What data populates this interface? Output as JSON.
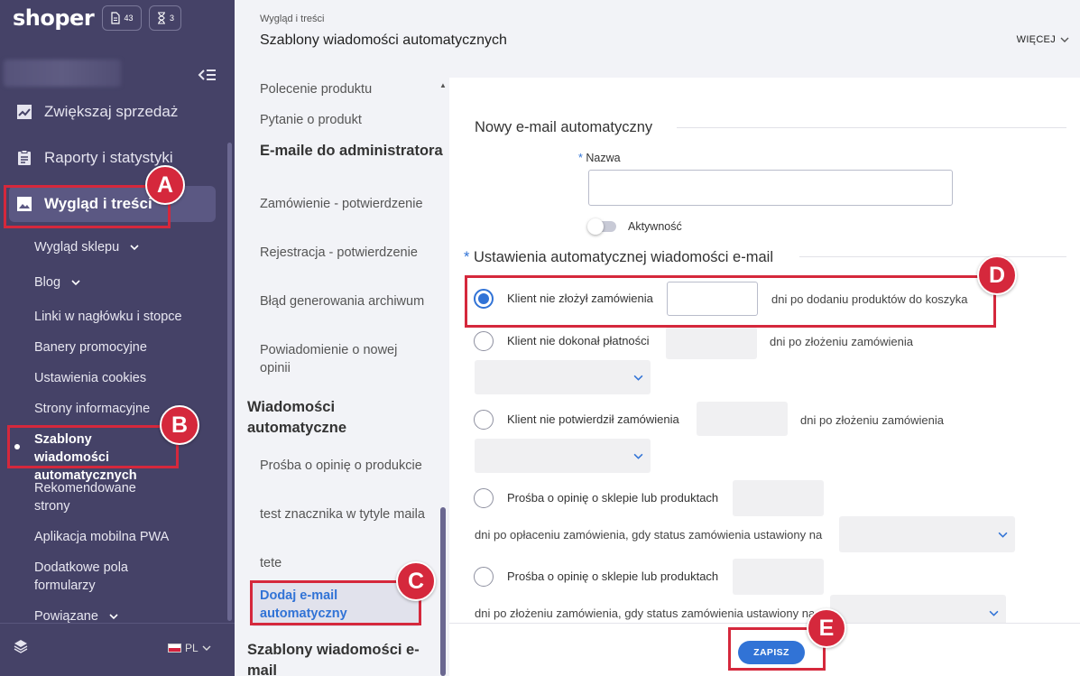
{
  "app": {
    "logo": "shoper",
    "counter1": "43",
    "counter2": "3",
    "language": "PL"
  },
  "sidebar": {
    "main_items": [
      {
        "label": "Zwiększaj sprzedaż",
        "icon": "chart-line-icon"
      },
      {
        "label": "Raporty i statystyki",
        "icon": "clipboard-icon"
      },
      {
        "label": "Wygląd i treści",
        "icon": "image-icon"
      }
    ],
    "sub_items": [
      "Wygląd sklepu",
      "Blog",
      "Linki w nagłówku i stopce",
      "Banery promocyjne",
      "Ustawienia cookies",
      "Strony informacyjne",
      "Szablony wiadomości automatycznych",
      "Rekomendowane strony",
      "Aplikacja mobilna PWA",
      "Dodatkowe pola formularzy",
      "Powiązane"
    ]
  },
  "header": {
    "breadcrumb": "Wygląd i treści",
    "title": "Szablony wiadomości automatycznych",
    "more_label": "WIĘCEJ"
  },
  "midcol": {
    "items": [
      "Polecenie produktu",
      "Pytanie o produkt",
      "E-maile do administratora",
      "Zamówienie - potwierdzenie",
      "Rejestracja - potwierdzenie",
      "Błąd generowania archiwum",
      "Powiadomienie o nowej opinii",
      "Wiadomości automatyczne",
      "Prośba o opinię o produkcie",
      "test znacznika w tytyle maila",
      "tete",
      "Dodaj e-mail automatyczny",
      "Szablony wiadomości e-mail"
    ]
  },
  "form": {
    "section1_title": "Nowy e-mail automatyczny",
    "name_label": "Nazwa",
    "name_value": "",
    "activity_label": "Aktywność",
    "activity_on": false,
    "required_mark": "*",
    "section2_title": "Ustawienia automatycznej wiadomości e-mail",
    "options": [
      {
        "label": "Klient nie złożył zamówienia",
        "suffix": "dni po dodaniu produktów do koszyka",
        "checked": true
      },
      {
        "label": "Klient nie dokonał płatności",
        "suffix": "dni po złożeniu zamówienia",
        "checked": false
      },
      {
        "label": "Klient nie potwierdził zamówienia",
        "suffix": "dni po złożeniu zamówienia",
        "checked": false
      },
      {
        "label": "Prośba o opinię o sklepie lub produktach",
        "suffix": "dni po opłaceniu zamówienia, gdy status zamówienia ustawiony na",
        "checked": false
      },
      {
        "label": "Prośba o opinię o sklepie lub produktach",
        "suffix": "dni po złożeniu zamówienia, gdy status zamówienia ustawiony na",
        "checked": false
      }
    ]
  },
  "footer": {
    "save_label": "ZAPISZ"
  },
  "annotations": {
    "a": "A",
    "b": "B",
    "c": "C",
    "d": "D",
    "e": "E",
    "color": "#d5283c"
  },
  "colors": {
    "sidebar_bg": "#454267",
    "accent": "#3173d6"
  }
}
